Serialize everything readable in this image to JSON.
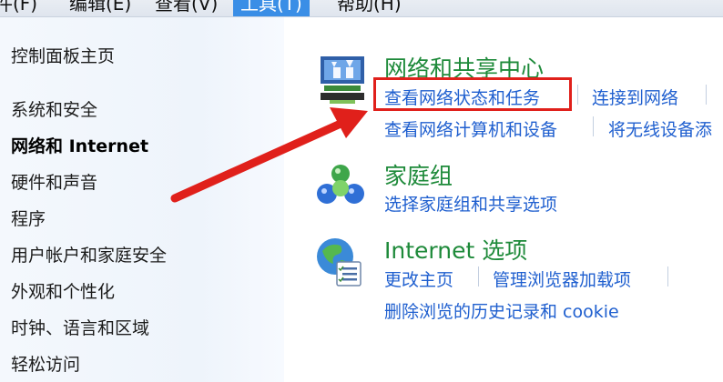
{
  "menubar": {
    "items": [
      {
        "label": "件(F)"
      },
      {
        "label": "编辑(E)"
      },
      {
        "label": "查看(V)"
      },
      {
        "label": "工具(T)"
      },
      {
        "label": "帮助(H)"
      }
    ]
  },
  "sidebar": {
    "items": [
      {
        "label": "控制面板主页"
      },
      {
        "label": "系统和安全"
      },
      {
        "label": "网络和 Internet"
      },
      {
        "label": "硬件和声音"
      },
      {
        "label": "程序"
      },
      {
        "label": "用户帐户和家庭安全"
      },
      {
        "label": "外观和个性化"
      },
      {
        "label": "时钟、语言和区域"
      },
      {
        "label": "轻松访问"
      }
    ]
  },
  "categories": {
    "network": {
      "title": "网络和共享中心",
      "links": [
        "查看网络状态和任务",
        "连接到网络",
        "查看网络计算机和设备",
        "将无线设备添"
      ]
    },
    "homegroup": {
      "title": "家庭组",
      "links": [
        "选择家庭组和共享选项"
      ]
    },
    "internet_options": {
      "title": "Internet 选项",
      "links": [
        "更改主页",
        "管理浏览器加载项",
        "删除浏览的历史记录和 cookie"
      ]
    }
  },
  "colors": {
    "category_title": "#1e8a3a",
    "link": "#1f5fcf",
    "annotation_red": "#e0201b",
    "menu_active": "#3a8ee6"
  }
}
